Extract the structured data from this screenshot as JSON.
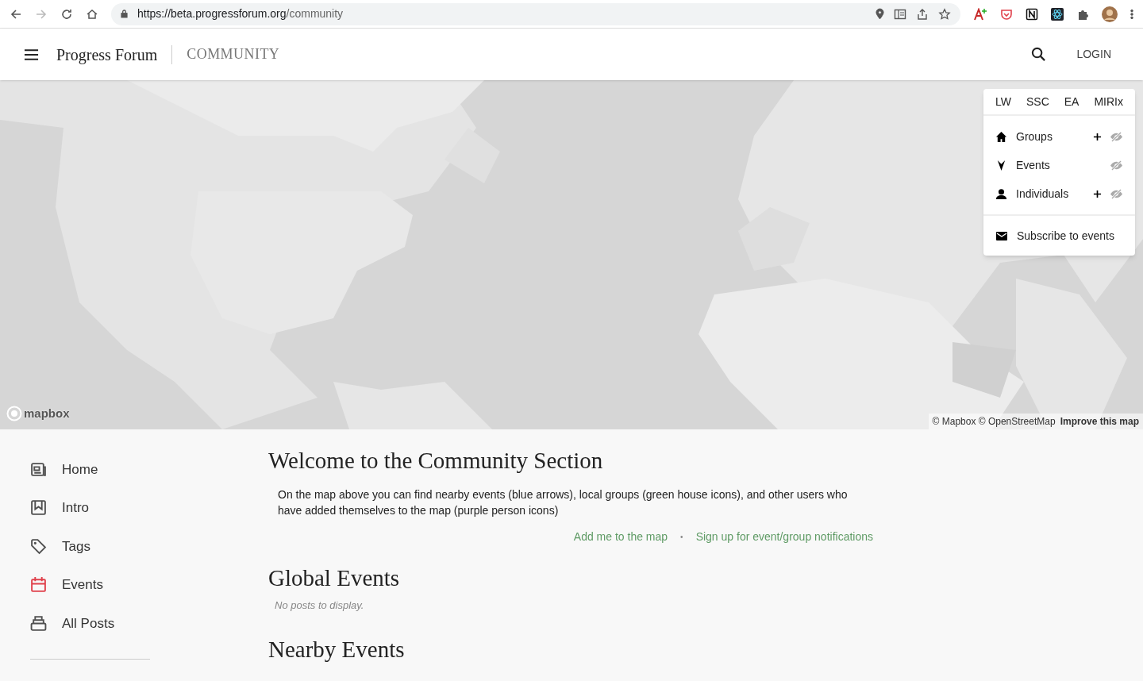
{
  "browser": {
    "url_host": "https://beta.progressforum.org",
    "url_path": "/community"
  },
  "header": {
    "site_title": "Progress Forum",
    "section": "COMMUNITY",
    "login": "LOGIN"
  },
  "map": {
    "kind": "picture",
    "logo": "mapbox",
    "attribution": "© Mapbox © OpenStreetMap",
    "improve_link": "Improve this map"
  },
  "map_panel": {
    "tabs": [
      {
        "label": "LW"
      },
      {
        "label": "SSC"
      },
      {
        "label": "EA"
      },
      {
        "label": "MIRIx"
      }
    ],
    "layers": [
      {
        "kind": "house",
        "label": "Groups",
        "addable": true
      },
      {
        "kind": "arrow",
        "label": "Events",
        "addable": false
      },
      {
        "kind": "person",
        "label": "Individuals",
        "addable": true
      }
    ],
    "subscribe": "Subscribe to events"
  },
  "sidebar": {
    "items": [
      {
        "kind": "home",
        "label": "Home",
        "color": "#505050"
      },
      {
        "kind": "intro",
        "label": "Intro",
        "color": "#505050"
      },
      {
        "kind": "tags",
        "label": "Tags",
        "color": "#505050"
      },
      {
        "kind": "events",
        "label": "Events",
        "color": "#e0404b"
      },
      {
        "kind": "posts",
        "label": "All Posts",
        "color": "#505050"
      }
    ]
  },
  "main": {
    "welcome_title": "Welcome to the Community Section",
    "intro": "On the map above you can find nearby events (blue arrows), local groups (green house icons), and other users who have added themselves to the map (purple person icons)",
    "links": [
      "Add me to the map",
      "Sign up for event/group notifications"
    ],
    "link_separator": "•",
    "global_title": "Global Events",
    "global_empty": "No posts to display.",
    "nearby_title": "Nearby Events"
  }
}
